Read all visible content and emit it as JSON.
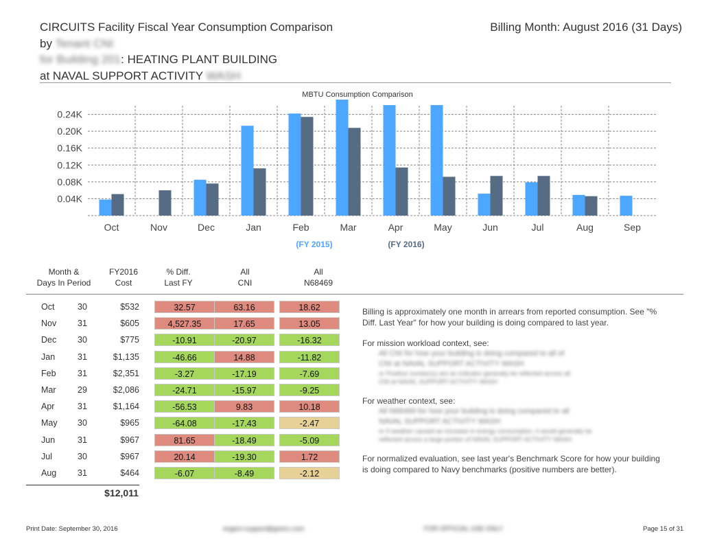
{
  "header": {
    "title": "CIRCUITS Facility Fiscal Year Consumption Comparison",
    "by_label": "by",
    "by_name": "Tenant CNI",
    "building_prefix": "for Building 201",
    "building_name": ": HEATING PLANT BUILDING",
    "activity": "at NAVAL SUPPORT ACTIVITY",
    "activity_code": "WASH",
    "billing": "Billing Month: August 2016  (31 Days)"
  },
  "chart_data": {
    "type": "bar",
    "title": "MBTU Consumption Comparison",
    "categories": [
      "Oct",
      "Nov",
      "Dec",
      "Jan",
      "Feb",
      "Mar",
      "Apr",
      "May",
      "Jun",
      "Jul",
      "Aug",
      "Sep"
    ],
    "series": [
      {
        "name": "(FY 2015)",
        "color": "#4da6ff",
        "values": [
          38,
          0,
          85,
          213,
          242,
          275,
          262,
          262,
          52,
          79,
          49,
          47
        ]
      },
      {
        "name": "(FY 2016)",
        "color": "#566c84",
        "values": [
          51,
          60,
          76,
          112,
          234,
          208,
          114,
          92,
          94,
          94,
          46,
          null
        ]
      }
    ],
    "yticks": [
      "0.04K",
      "0.08K",
      "0.12K",
      "0.16K",
      "0.20K",
      "0.24K"
    ],
    "ytick_values": [
      40,
      80,
      120,
      160,
      200,
      240
    ],
    "ylim": [
      0,
      280
    ],
    "grid": true,
    "legend": "bottom-center"
  },
  "columns": [
    {
      "line1": "Month &",
      "line2": "Days In Period"
    },
    {
      "line1": "FY2016",
      "line2": "Cost"
    },
    {
      "line1": "% Diff.",
      "line2": "Last FY"
    },
    {
      "line1": "All",
      "line2": "CNI"
    },
    {
      "line1": "All",
      "line2": "N68469"
    }
  ],
  "rows": [
    {
      "month": "Oct",
      "days": "30",
      "cost": "$532",
      "diff": {
        "v": "32.57",
        "c": "red"
      },
      "cni": {
        "v": "63.16",
        "c": "red"
      },
      "n": {
        "v": "18.62",
        "c": "red"
      }
    },
    {
      "month": "Nov",
      "days": "31",
      "cost": "$605",
      "diff": {
        "v": "4,527.35",
        "c": "red"
      },
      "cni": {
        "v": "17.65",
        "c": "red"
      },
      "n": {
        "v": "13.05",
        "c": "red"
      }
    },
    {
      "month": "Dec",
      "days": "30",
      "cost": "$775",
      "diff": {
        "v": "-10.91",
        "c": "green"
      },
      "cni": {
        "v": "-20.97",
        "c": "green"
      },
      "n": {
        "v": "-16.32",
        "c": "green"
      }
    },
    {
      "month": "Jan",
      "days": "31",
      "cost": "$1,135",
      "diff": {
        "v": "-46.66",
        "c": "green"
      },
      "cni": {
        "v": "14.88",
        "c": "red"
      },
      "n": {
        "v": "-11.82",
        "c": "green"
      }
    },
    {
      "month": "Feb",
      "days": "31",
      "cost": "$2,351",
      "diff": {
        "v": "-3.27",
        "c": "green"
      },
      "cni": {
        "v": "-17.19",
        "c": "green"
      },
      "n": {
        "v": "-7.69",
        "c": "green"
      }
    },
    {
      "month": "Mar",
      "days": "29",
      "cost": "$2,086",
      "diff": {
        "v": "-24.71",
        "c": "green"
      },
      "cni": {
        "v": "-15.97",
        "c": "green"
      },
      "n": {
        "v": "-9.25",
        "c": "green"
      }
    },
    {
      "month": "Apr",
      "days": "31",
      "cost": "$1,164",
      "diff": {
        "v": "-56.53",
        "c": "green"
      },
      "cni": {
        "v": "9.83",
        "c": "red"
      },
      "n": {
        "v": "10.18",
        "c": "red"
      }
    },
    {
      "month": "May",
      "days": "30",
      "cost": "$965",
      "diff": {
        "v": "-64.08",
        "c": "green"
      },
      "cni": {
        "v": "-17.43",
        "c": "green"
      },
      "n": {
        "v": "-2.47",
        "c": "tan"
      }
    },
    {
      "month": "Jun",
      "days": "31",
      "cost": "$967",
      "diff": {
        "v": "81.65",
        "c": "red"
      },
      "cni": {
        "v": "-18.49",
        "c": "green"
      },
      "n": {
        "v": "-5.09",
        "c": "green"
      }
    },
    {
      "month": "Jul",
      "days": "30",
      "cost": "$967",
      "diff": {
        "v": "20.14",
        "c": "red"
      },
      "cni": {
        "v": "-19.30",
        "c": "green"
      },
      "n": {
        "v": "1.72",
        "c": "red"
      }
    },
    {
      "month": "Aug",
      "days": "31",
      "cost": "$464",
      "diff": {
        "v": "-6.07",
        "c": "green"
      },
      "cni": {
        "v": "-8.49",
        "c": "green"
      },
      "n": {
        "v": "-2.12",
        "c": "tan"
      }
    }
  ],
  "total": "$12,011",
  "notes": {
    "p1": "Billing is approximately one month in arrears from reported consumption. See \"% Diff. Last Year\" for how your building is doing compared to last year.",
    "p2": "For mission workload context, see:",
    "p2_b1": "All CNI for how your building is doing compared to all of",
    "p2_b2": "CNI at NAVAL SUPPORT ACTIVITY WASH",
    "p2_b3": "or Positive number(s) are an indicator generally be reflected across all",
    "p2_b4": "CNI at NAVAL SUPPORT ACTIVITY WASH",
    "p3": "For weather context, see:",
    "p3_b1": "All N68469 for how your building is doing compared to all",
    "p3_b2": "NAVAL SUPPORT ACTIVITY WASH",
    "p3_b3": "or If weather caused an increase in energy consumption, it would generally be",
    "p3_b4": "reflected across a large portion of NAVAL SUPPORT ACTIVITY WASH",
    "p4": "For normalized evaluation, see last year's Benchmark Score for how your building is doing compared to Navy benchmarks (positive numbers are better)."
  },
  "footer": {
    "print_date": "Print Date: September 30, 2016",
    "email": "esgem-support@gsimc.com",
    "classification": "FOR OFFICIAL USE ONLY",
    "page": "Page 15 of 31"
  }
}
